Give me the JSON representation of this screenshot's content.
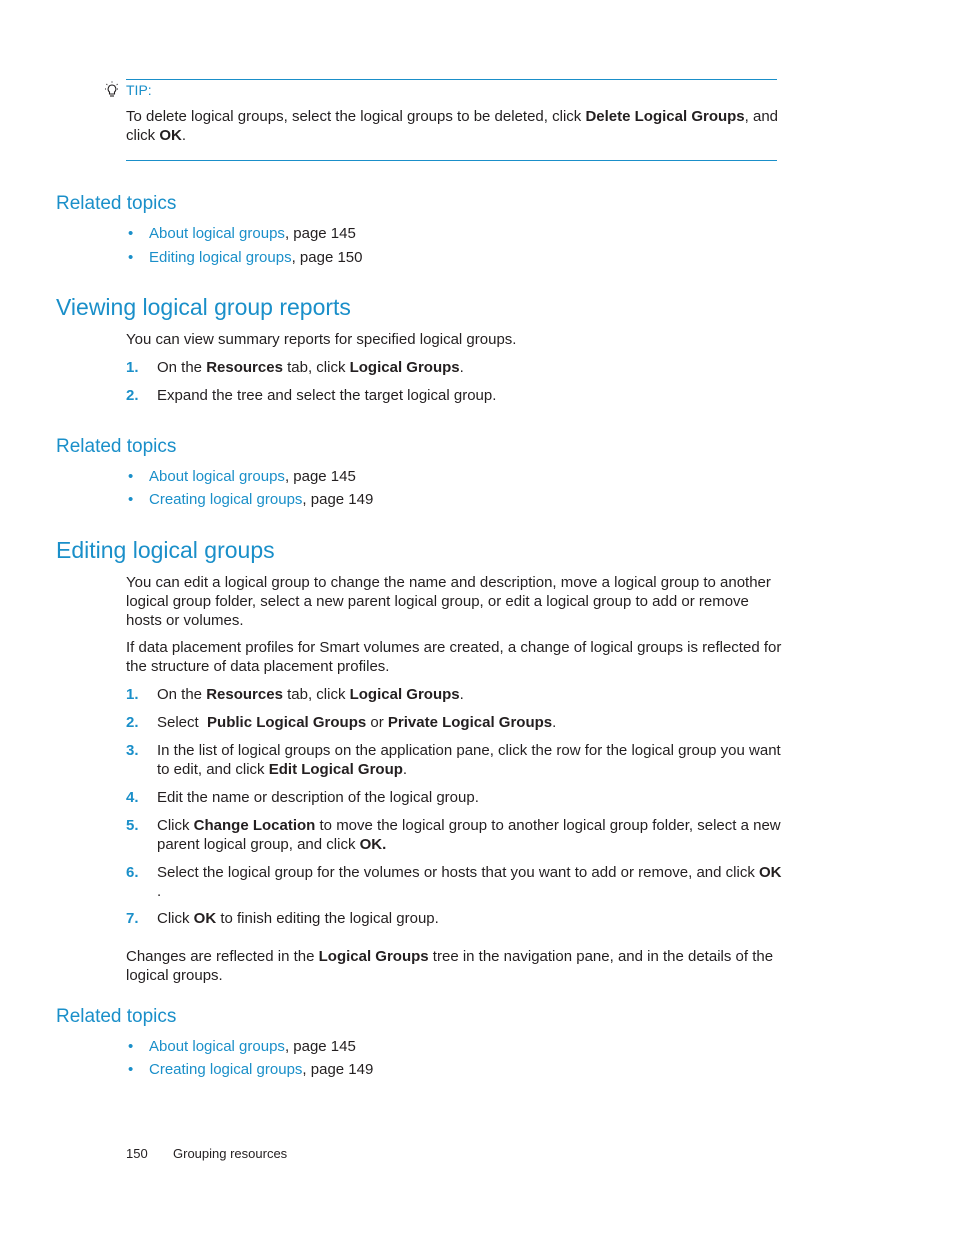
{
  "tip": {
    "label": "TIP:",
    "text_1": "To delete logical groups, select the logical groups to be deleted, click ",
    "bold_1": "Delete Logical Groups",
    "text_2": ", and",
    "text_3": "click ",
    "bold_2": "OK",
    "text_4": "."
  },
  "related_1": {
    "heading": "Related topics",
    "items": [
      {
        "link": "About logical groups",
        "suffix": ", page 145"
      },
      {
        "link": "Editing logical groups",
        "suffix": ", page 150"
      }
    ]
  },
  "viewing": {
    "heading": "Viewing logical group reports",
    "intro": "You can view summary reports for specified logical groups.",
    "steps": [
      {
        "num": "1.",
        "t1": "On the ",
        "b1": "Resources",
        "t2": " tab, click ",
        "b2": "Logical Groups",
        "t3": "."
      },
      {
        "num": "2.",
        "t1": "Expand the tree and select the target logical group."
      }
    ]
  },
  "related_2": {
    "heading": "Related topics",
    "items": [
      {
        "link": "About logical groups",
        "suffix": ", page 145"
      },
      {
        "link": "Creating logical groups",
        "suffix": ", page 149"
      }
    ]
  },
  "editing": {
    "heading": "Editing logical groups",
    "para_1_line_1": "You can edit a logical group to change the name and description, move a logical group to another",
    "para_1_line_2": "logical group folder, select a new parent logical group, or edit a logical group to add or remove",
    "para_1_line_3": "hosts or volumes.",
    "para_2_line_1": "If data placement profiles for Smart volumes are created, a change of logical groups is reflected for",
    "para_2_line_2": "the structure of data placement profiles.",
    "steps": [
      {
        "num": "1.",
        "t1": "On the ",
        "b1": "Resources",
        "t2": " tab, click ",
        "b2": "Logical Groups",
        "t3": "."
      },
      {
        "num": "2.",
        "t1": "Select  ",
        "b1": "Public Logical Groups",
        "t2": " or ",
        "b2": "Private Logical Groups",
        "t3": "."
      },
      {
        "num": "3.",
        "t1": "In the list of logical groups on the application pane, click the row for the logical group you want",
        "t2": "to edit, and click ",
        "b1": "Edit Logical Group",
        "t3": "."
      },
      {
        "num": "4.",
        "t1": "Edit the name or description of the logical group."
      },
      {
        "num": "5.",
        "t1": "Click ",
        "b1": "Change Location",
        "t2": " to move the logical group to another logical group folder, select a new",
        "t3": "parent logical group, and click ",
        "b2": "OK."
      },
      {
        "num": "6.",
        "t1": "Select the logical group for the volumes or hosts that you want to add or remove, and click ",
        "b1": "OK",
        "t2": "."
      },
      {
        "num": "7.",
        "t1": "Click ",
        "b1": "OK",
        "t2": " to finish editing the logical group."
      }
    ],
    "closing_1": "Changes are reflected in the ",
    "closing_bold": "Logical Groups",
    "closing_2": " tree in the navigation pane, and in the details of the",
    "closing_3": "logical groups."
  },
  "related_3": {
    "heading": "Related topics",
    "items": [
      {
        "link": "About logical groups",
        "suffix": ", page 145"
      },
      {
        "link": "Creating logical groups",
        "suffix": ", page 149"
      }
    ]
  },
  "footer": {
    "page_number": "150",
    "section": "Grouping resources"
  },
  "icons": {
    "tip": "lightbulb-icon"
  }
}
